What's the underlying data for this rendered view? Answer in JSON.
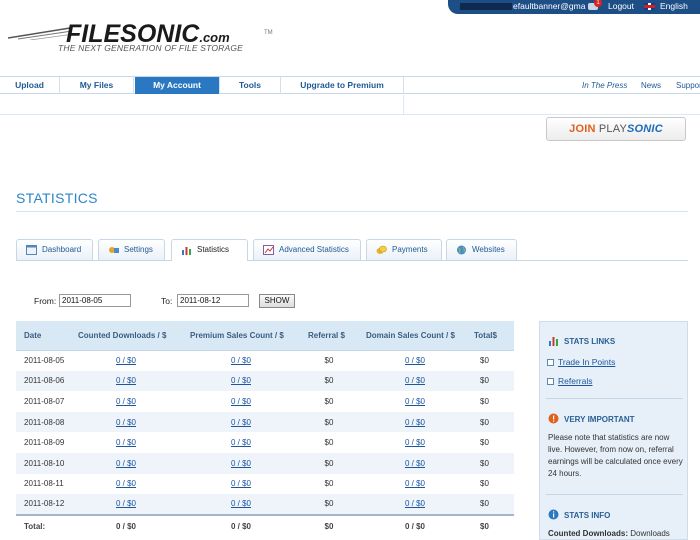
{
  "topbar": {
    "email": "efaultbanner@gma",
    "messages_count": "1",
    "logout": "Logout",
    "language": "English"
  },
  "header": {
    "brand": "FILESONIC",
    "brand_suffix": ".com",
    "trademark": "TM",
    "tagline": "THE NEXT GENERATION OF FILE STORAGE"
  },
  "nav": {
    "items": [
      "Upload",
      "My Files",
      "My Account",
      "Tools",
      "Upgrade to Premium"
    ],
    "active_index": 2,
    "right_links": [
      "In The Press",
      "News",
      "Support"
    ]
  },
  "join_button": {
    "join": "JOIN ",
    "play": "PLAY",
    "sonic": "SONIC"
  },
  "page_title": "STATISTICS",
  "tabs": [
    {
      "label": "Dashboard",
      "icon": "dashboard-icon"
    },
    {
      "label": "Settings",
      "icon": "settings-icon"
    },
    {
      "label": "Statistics",
      "icon": "bar-chart-icon",
      "active": true
    },
    {
      "label": "Advanced Statistics",
      "icon": "advanced-chart-icon"
    },
    {
      "label": "Payments",
      "icon": "coins-icon"
    },
    {
      "label": "Websites",
      "icon": "globe-icon"
    }
  ],
  "filter": {
    "from_label": "From:",
    "from_value": "2011-08-05",
    "to_label": "To:",
    "to_value": "2011-08-12",
    "show_button": "SHOW"
  },
  "table": {
    "headers": [
      "Date",
      "Counted Downloads / $",
      "Premium Sales Count / $",
      "Referral $",
      "Domain Sales Count / $",
      "Total$"
    ],
    "rows": [
      {
        "date": "2011-08-05",
        "downloads": "0 / $0",
        "premium": "0 / $0",
        "referral": "$0",
        "domain": "0 / $0",
        "total": "$0"
      },
      {
        "date": "2011-08-06",
        "downloads": "0 / $0",
        "premium": "0 / $0",
        "referral": "$0",
        "domain": "0 / $0",
        "total": "$0"
      },
      {
        "date": "2011-08-07",
        "downloads": "0 / $0",
        "premium": "0 / $0",
        "referral": "$0",
        "domain": "0 / $0",
        "total": "$0"
      },
      {
        "date": "2011-08-08",
        "downloads": "0 / $0",
        "premium": "0 / $0",
        "referral": "$0",
        "domain": "0 / $0",
        "total": "$0"
      },
      {
        "date": "2011-08-09",
        "downloads": "0 / $0",
        "premium": "0 / $0",
        "referral": "$0",
        "domain": "0 / $0",
        "total": "$0"
      },
      {
        "date": "2011-08-10",
        "downloads": "0 / $0",
        "premium": "0 / $0",
        "referral": "$0",
        "domain": "0 / $0",
        "total": "$0"
      },
      {
        "date": "2011-08-11",
        "downloads": "0 / $0",
        "premium": "0 / $0",
        "referral": "$0",
        "domain": "0 / $0",
        "total": "$0"
      },
      {
        "date": "2011-08-12",
        "downloads": "0 / $0",
        "premium": "0 / $0",
        "referral": "$0",
        "domain": "0 / $0",
        "total": "$0"
      }
    ],
    "total": {
      "label": "Total:",
      "downloads": "0 / $0",
      "premium": "0 / $0",
      "referral": "$0",
      "domain": "0 / $0",
      "total": "$0"
    }
  },
  "side": {
    "links_title": "STATS LINKS",
    "links": [
      "Trade In Points",
      "Referrals"
    ],
    "important_title": "VERY IMPORTANT",
    "important_text": "Please note that statistics are now live. However, from now on, referral earnings will be calculated once every 24 hours.",
    "info_title": "STATS INFO",
    "info_term": "Counted Downloads:",
    "info_text": " Downloads"
  },
  "colors": {
    "accent": "#2b78c2",
    "title": "#2b87c8",
    "topbar": "#1d4e86",
    "table_header": "#d9e8f5",
    "important": "#e0611c"
  }
}
